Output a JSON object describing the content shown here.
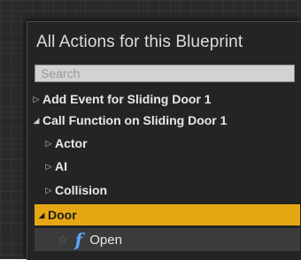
{
  "menu": {
    "title": "All Actions for this Blueprint",
    "search": {
      "placeholder": "Search",
      "value": ""
    },
    "items": [
      {
        "label": "Add Event for Sliding Door 1",
        "icon": "triangle-right-outline-icon"
      },
      {
        "label": "Call Function on Sliding Door 1",
        "icon": "triangle-down-icon"
      },
      {
        "label": "Actor",
        "icon": "triangle-right-outline-icon"
      },
      {
        "label": "AI",
        "icon": "triangle-right-outline-icon"
      },
      {
        "label": "Collision",
        "icon": "triangle-right-outline-icon"
      },
      {
        "label": "Door",
        "icon": "triangle-down-icon"
      },
      {
        "label": "Open",
        "icon": "function-icon"
      }
    ]
  },
  "icons": {
    "expand_collapsed": "▷",
    "expand_open": "◢",
    "favorite": "☆",
    "function": "f"
  },
  "colors": {
    "selected_category": "#e5a713",
    "function_icon": "#5aa8ff",
    "menu_background": "#242424"
  }
}
